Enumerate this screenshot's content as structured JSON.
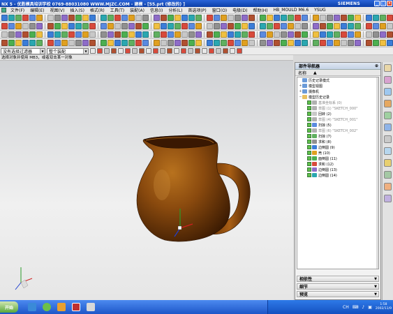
{
  "window": {
    "title": "NX 5 - 优胜模具培训学校  0769-88031080  WWW.MJZC.COM - 建模 - [55.prt (修改的) ]",
    "brand": "SIEMENS"
  },
  "menu": [
    "文件(F)",
    "编辑(E)",
    "视图(V)",
    "插入(S)",
    "格式(R)",
    "工具(T)",
    "装配(A)",
    "信息(I)",
    "分析(L)",
    "首选项(P)",
    "窗口(O)",
    "电极(D)",
    "帮助(H)",
    "HB_MOULD M6.6",
    "YSUG"
  ],
  "selection": {
    "filter": "没有选择过滤器",
    "scope": "整个装配"
  },
  "cue_line": "选择对象并使用 MB3，或者双击某一对象",
  "navigator": {
    "title": "部件导航器",
    "column_header": "名称",
    "sort_indicator": "▲",
    "items": [
      {
        "label": "历史记录模式",
        "level": 0,
        "expander": ""
      },
      {
        "label": "模型视图",
        "level": 0,
        "expander": "+"
      },
      {
        "label": "摄像机",
        "level": 0,
        "expander": "+"
      },
      {
        "label": "模型历史记录",
        "level": 0,
        "expander": "−"
      },
      {
        "label": "基准坐标系 (0)",
        "level": 1,
        "grey": true
      },
      {
        "label": "草图 (1) \"SKETCH_000\"",
        "level": 1,
        "grey": true
      },
      {
        "label": "回转 (2)",
        "level": 1
      },
      {
        "label": "草图 (4) \"SKETCH_001\"",
        "level": 1,
        "grey": true
      },
      {
        "label": "扫掠 (5)",
        "level": 1
      },
      {
        "label": "草图 (6) \"SKETCH_002\"",
        "level": 1,
        "grey": true
      },
      {
        "label": "扫掠 (7)",
        "level": 1
      },
      {
        "label": "求和 (8)",
        "level": 1
      },
      {
        "label": "边倒圆 (9)",
        "level": 1
      },
      {
        "label": "壳 (10)",
        "level": 1
      },
      {
        "label": "面倒圆 (11)",
        "level": 1
      },
      {
        "label": "求和 (12)",
        "level": 1
      },
      {
        "label": "边倒圆 (13)",
        "level": 1
      },
      {
        "label": "边倒圆 (14)",
        "level": 1
      }
    ],
    "sections": [
      "相依性",
      "细节",
      "预览"
    ]
  },
  "taskbar": {
    "start_label": "开始",
    "tray_lang": "CH",
    "time": "1:58",
    "date": "2002/11/9"
  }
}
